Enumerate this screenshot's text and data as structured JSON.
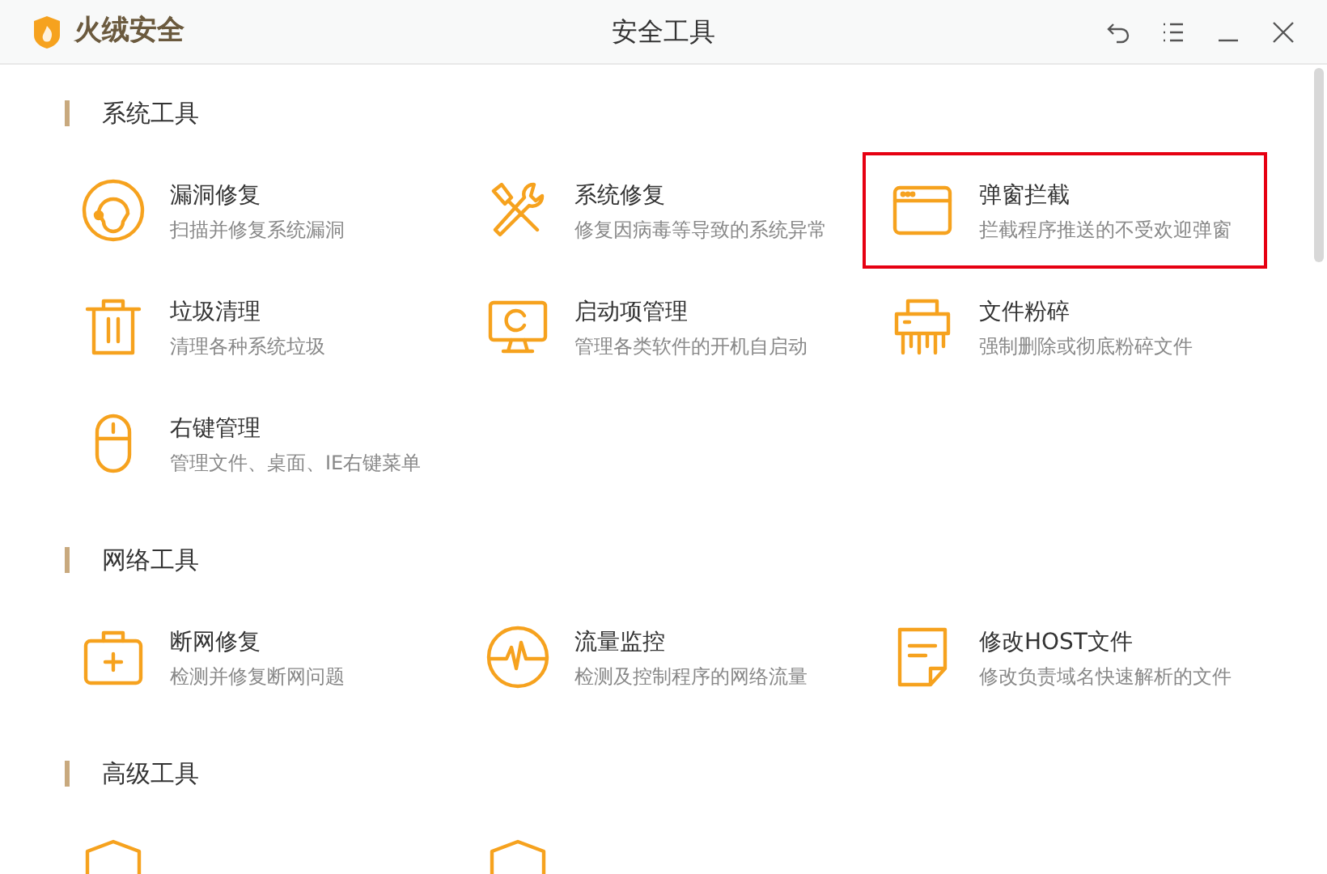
{
  "app": {
    "name": "火绒安全"
  },
  "window": {
    "title": "安全工具"
  },
  "sections": [
    {
      "title": "系统工具",
      "items": [
        {
          "kind": "bug",
          "title": "漏洞修复",
          "description": "扫描并修复系统漏洞",
          "highlighted": false
        },
        {
          "kind": "tools",
          "title": "系统修复",
          "description": "修复因病毒等导致的系统异常",
          "highlighted": false
        },
        {
          "kind": "window",
          "title": "弹窗拦截",
          "description": "拦截程序推送的不受欢迎弹窗",
          "highlighted": true
        },
        {
          "kind": "trash",
          "title": "垃圾清理",
          "description": "清理各种系统垃圾",
          "highlighted": false
        },
        {
          "kind": "monitor",
          "title": "启动项管理",
          "description": "管理各类软件的开机自启动",
          "highlighted": false
        },
        {
          "kind": "shredder",
          "title": "文件粉碎",
          "description": "强制删除或彻底粉碎文件",
          "highlighted": false
        },
        {
          "kind": "mouse",
          "title": "右键管理",
          "description": "管理文件、桌面、IE右键菜单",
          "highlighted": false
        }
      ]
    },
    {
      "title": "网络工具",
      "items": [
        {
          "kind": "kit",
          "title": "断网修复",
          "description": "检测并修复断网问题",
          "highlighted": false
        },
        {
          "kind": "pulse",
          "title": "流量监控",
          "description": "检测及控制程序的网络流量",
          "highlighted": false
        },
        {
          "kind": "note",
          "title": "修改HOST文件",
          "description": "修改负责域名快速解析的文件",
          "highlighted": false
        }
      ]
    },
    {
      "title": "高级工具",
      "items": [
        {
          "kind": "shield",
          "highlighted": false
        },
        {
          "kind": "shield",
          "highlighted": false
        }
      ]
    }
  ]
}
